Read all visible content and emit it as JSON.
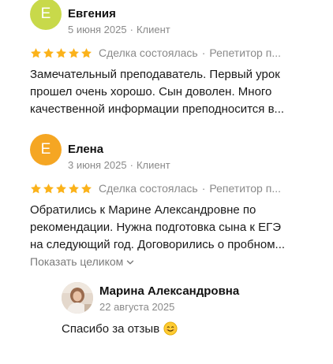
{
  "reviews": [
    {
      "avatar_letter": "E",
      "avatar_color": "#c8d94a",
      "name": "Евгения",
      "date": "5 июня 2025",
      "role": "Клиент",
      "stars": 5,
      "deal": "Сделка состоялась",
      "service": "Репетитор п...",
      "text_lines": [
        "Замечательный преподаватель. Первый урок",
        "прошел очень хорошо. Сын доволен. Много",
        "качественной информации преподносится в..."
      ]
    },
    {
      "avatar_letter": "E",
      "avatar_color": "#f5a623",
      "name": "Елена",
      "date": "3 июня 2025",
      "role": "Клиент",
      "stars": 5,
      "deal": "Сделка состоялась",
      "service": "Репетитор п...",
      "text_lines": [
        "Обратились к Марине Александровне по",
        "рекомендации. Нужна подготовка сына к ЕГЭ",
        "на следующий год. Договорились о пробном..."
      ],
      "expand_label": "Показать целиком"
    }
  ],
  "reply": {
    "name": "Марина Александровна",
    "date": "22 августа 2025",
    "text": "Спасибо за отзыв"
  },
  "meta_separator": "·",
  "colors": {
    "star": "#fbb21a",
    "muted": "#8a8a8a"
  }
}
